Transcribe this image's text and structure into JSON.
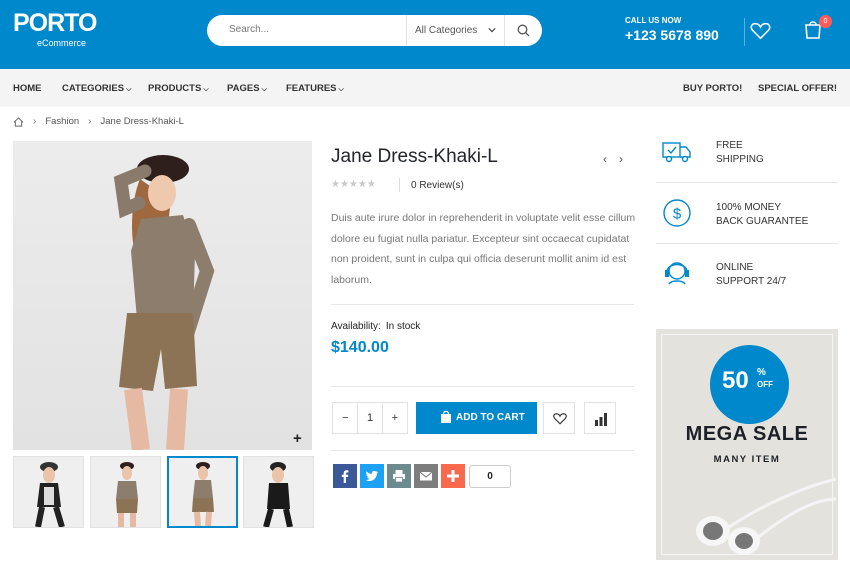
{
  "header": {
    "logo_title": "PORTO",
    "logo_subtitle": "eCommerce",
    "search_placeholder": "Search...",
    "category_select": "All Categories",
    "call_label": "CALL US NOW",
    "call_number": "+123 5678 890",
    "cart_count": "0"
  },
  "nav": {
    "items": [
      "HOME",
      "CATEGORIES",
      "PRODUCTS",
      "PAGES",
      "FEATURES"
    ],
    "right_items": [
      "BUY PORTO!",
      "SPECIAL OFFER!"
    ]
  },
  "breadcrumb": {
    "items": [
      "Fashion",
      "Jane Dress-Khaki-L"
    ]
  },
  "product": {
    "title": "Jane Dress-Khaki-L",
    "reviews": "0 Review(s)",
    "rating": 0,
    "description": "Duis aute irure dolor in reprehenderit in voluptate velit esse cillum dolore eu fugiat nulla pariatur. Excepteur sint occaecat cupidatat non proident, sunt in culpa qui officia deserunt mollit anim id est laborum.",
    "availability_label": "Availability:",
    "availability_value": "In stock",
    "price": "$140.00",
    "quantity": "1",
    "add_to_cart": "ADD TO CART",
    "share_count": "0",
    "zoom": "+"
  },
  "features": [
    {
      "icon": "truck-icon",
      "line1": "FREE",
      "line2": "SHIPPING"
    },
    {
      "icon": "dollar-icon",
      "line1": "100% MONEY",
      "line2": "BACK GUARANTEE"
    },
    {
      "icon": "support-icon",
      "line1": "ONLINE",
      "line2": "SUPPORT 24/7"
    }
  ],
  "banner": {
    "percent": "50",
    "pct_sign": "%",
    "off": "OFF",
    "title": "MEGA SALE",
    "subtitle": "MANY ITEM"
  },
  "colors": {
    "primary": "#0088cc",
    "facebook": "#3b5998",
    "twitter": "#1da1f2",
    "print": "#6d8a8e",
    "email": "#7d7d7d",
    "addthis": "#f8694d"
  }
}
